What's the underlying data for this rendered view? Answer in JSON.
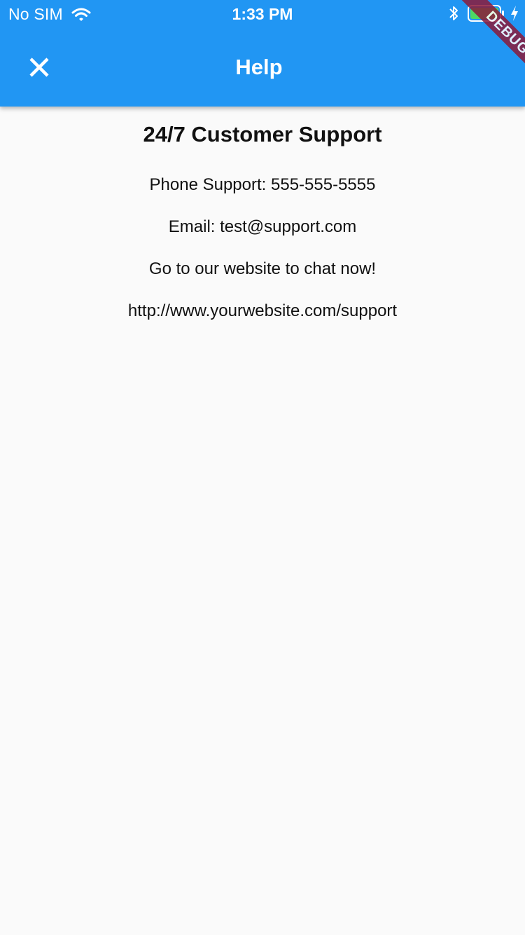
{
  "status_bar": {
    "carrier": "No SIM",
    "time": "1:33 PM",
    "icons": [
      "wifi-icon",
      "bluetooth-icon",
      "battery-icon",
      "charging-icon"
    ],
    "battery_color": "#4cd964"
  },
  "app_bar": {
    "title": "Help",
    "leading_icon": "close-icon",
    "background_color": "#2196f3"
  },
  "debug_banner": {
    "label": "DEBUG",
    "color": "#8b1a3a"
  },
  "content": {
    "heading": "24/7 Customer Support",
    "phone": "Phone Support: 555-555-5555",
    "email": "Email: test@support.com",
    "chat_prompt": "Go to our website to chat now!",
    "url": "http://www.yourwebsite.com/support"
  }
}
